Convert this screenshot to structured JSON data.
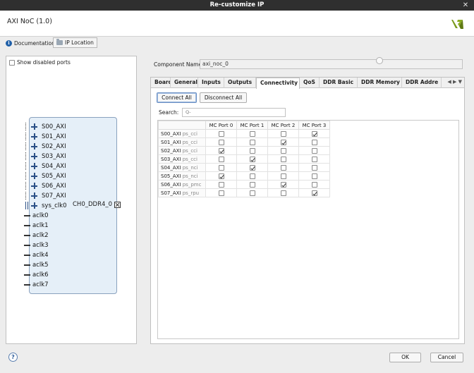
{
  "window": {
    "title": "Re-customize IP",
    "close_glyph": "✕"
  },
  "header": {
    "ip_name": "AXI NoC (1.0)",
    "logo_icon": "vivado-logo",
    "logo_color": "#7a9a1e"
  },
  "toolbar": {
    "documentation_label": "Documentation",
    "info_glyph": "i",
    "ip_location_label": "IP Location"
  },
  "left_panel": {
    "show_disabled_label": "Show disabled ports",
    "show_disabled_checked": false,
    "axi_ports": [
      "S00_AXI",
      "S01_AXI",
      "S02_AXI",
      "S03_AXI",
      "S04_AXI",
      "S05_AXI",
      "S06_AXI",
      "S07_AXI"
    ],
    "sys_clk_label": "sys_clk0",
    "ddr_port_label": "CH0_DDR4_0",
    "clock_ports": [
      "aclk0",
      "aclk1",
      "aclk2",
      "aclk3",
      "aclk4",
      "aclk5",
      "aclk6",
      "aclk7"
    ]
  },
  "component": {
    "label": "Component Name",
    "value": "axi_noc_0"
  },
  "tabs": [
    "Board",
    "General",
    "Inputs",
    "Outputs",
    "Connectivity",
    "QoS",
    "DDR Basic",
    "DDR Memory",
    "DDR Addre"
  ],
  "active_tab": "Connectivity",
  "tab_arrows": "◀ ▶ ▼",
  "connectivity": {
    "connect_all_label": "Connect All",
    "disconnect_all_label": "Disconnect All",
    "search_label": "Search:",
    "search_placeholder": "Q-",
    "columns": [
      "MC Port 0",
      "MC Port 1",
      "MC Port 2",
      "MC Port 3"
    ],
    "rows": [
      {
        "port": "S00_AXI",
        "type": "ps_cci",
        "checks": [
          false,
          false,
          false,
          true
        ]
      },
      {
        "port": "S01_AXI",
        "type": "ps_cci",
        "checks": [
          false,
          false,
          true,
          false
        ]
      },
      {
        "port": "S02_AXI",
        "type": "ps_cci",
        "checks": [
          true,
          false,
          false,
          false
        ]
      },
      {
        "port": "S03_AXI",
        "type": "ps_cci",
        "checks": [
          false,
          true,
          false,
          false
        ]
      },
      {
        "port": "S04_AXI",
        "type": "ps_nci",
        "checks": [
          false,
          true,
          false,
          false
        ]
      },
      {
        "port": "S05_AXI",
        "type": "ps_nci",
        "checks": [
          true,
          false,
          false,
          false
        ]
      },
      {
        "port": "S06_AXI",
        "type": "ps_pmc",
        "checks": [
          false,
          false,
          true,
          false
        ]
      },
      {
        "port": "S07_AXI",
        "type": "ps_rpu",
        "checks": [
          false,
          false,
          false,
          true
        ]
      }
    ]
  },
  "footer": {
    "help_glyph": "?",
    "ok_label": "OK",
    "cancel_label": "Cancel"
  }
}
